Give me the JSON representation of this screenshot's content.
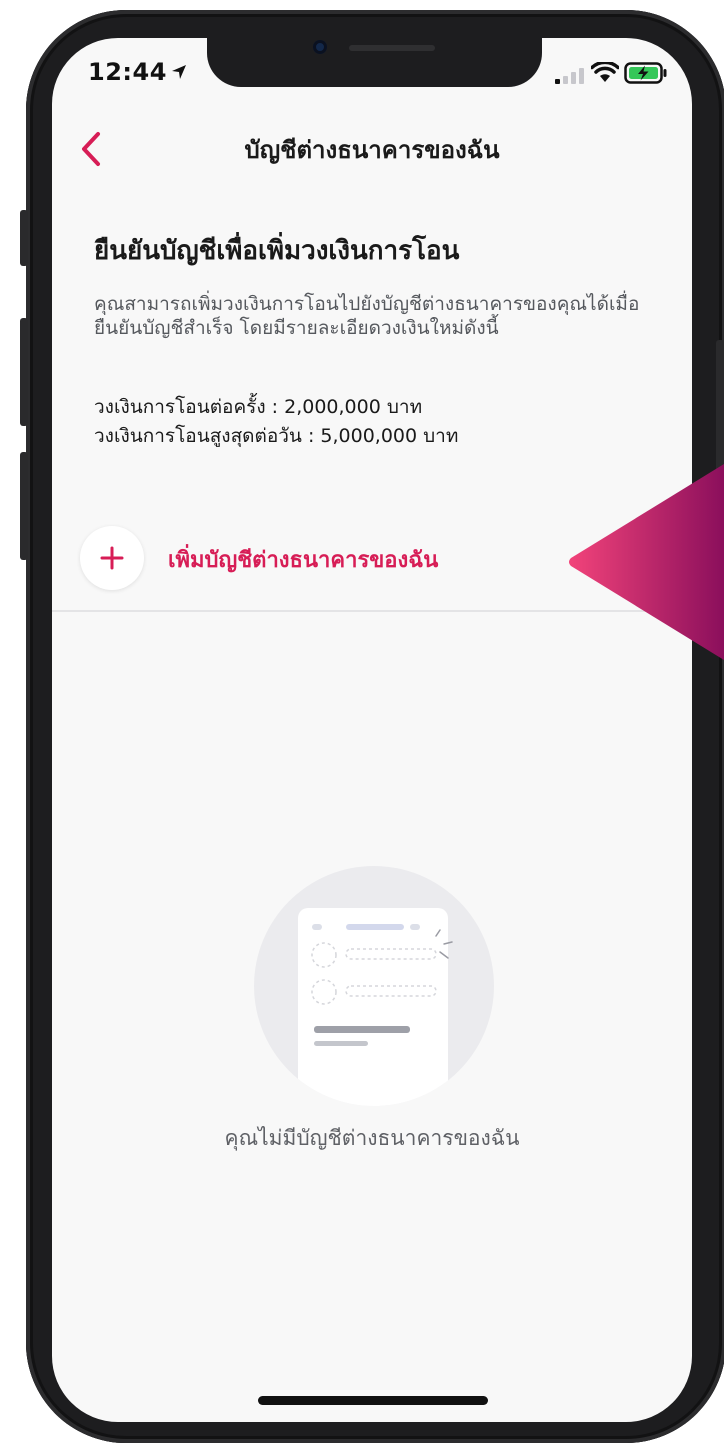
{
  "status_bar": {
    "time": "12:44"
  },
  "header": {
    "title": "บัญชีต่างธนาคารของฉัน"
  },
  "verify": {
    "heading": "ยืนยันบัญชีเพื่อเพิ่มวงเงินการโอน",
    "description": "คุณสามารถเพิ่มวงเงินการโอนไปยังบัญชีต่างธนาคารของคุณได้เมื่อยืนยันบัญชีสำเร็จ โดยมีรายละเอียดวงเงินใหม่ดังนี้",
    "limit_per_transaction": "วงเงินการโอนต่อครั้ง : 2,000,000 บาท",
    "limit_per_day": "วงเงินการโอนสูงสุดต่อวัน : 5,000,000 บาท"
  },
  "add_account": {
    "label": "เพิ่มบัญชีต่างธนาคารของฉัน"
  },
  "empty_state": {
    "message": "คุณไม่มีบัญชีต่างธนาคารของฉัน"
  },
  "colors": {
    "accent": "#d71d56",
    "pointer_start": "#f2437a",
    "pointer_end": "#8b0f5c"
  },
  "icons": {
    "back": "chevron-left-icon",
    "add": "plus-icon",
    "location": "location-arrow-icon",
    "signal": "cellular-signal-icon",
    "wifi": "wifi-icon",
    "battery": "battery-charging-icon",
    "empty": "empty-document-illustration"
  }
}
